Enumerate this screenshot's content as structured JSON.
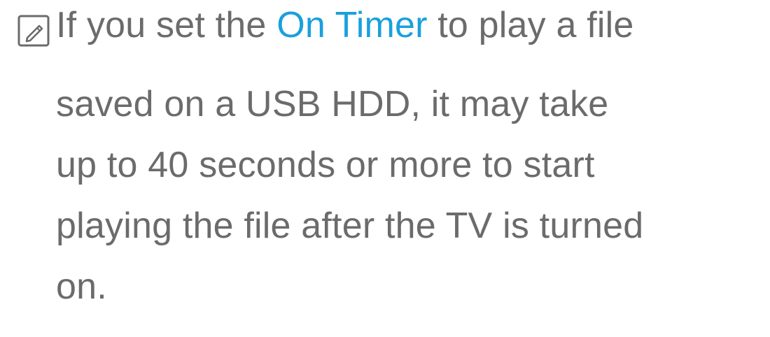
{
  "note": {
    "icon": "note-pencil-icon",
    "lines": [
      {
        "before": "If you set the ",
        "highlight": "On Timer",
        "after": " to play a file"
      },
      "saved on a USB HDD, it may take",
      "up to 40 seconds or more to start",
      "playing the file after the TV is turned",
      "on."
    ]
  },
  "colors": {
    "text": "#6b6b6b",
    "highlight": "#1aa0dc",
    "background": "#ffffff"
  }
}
